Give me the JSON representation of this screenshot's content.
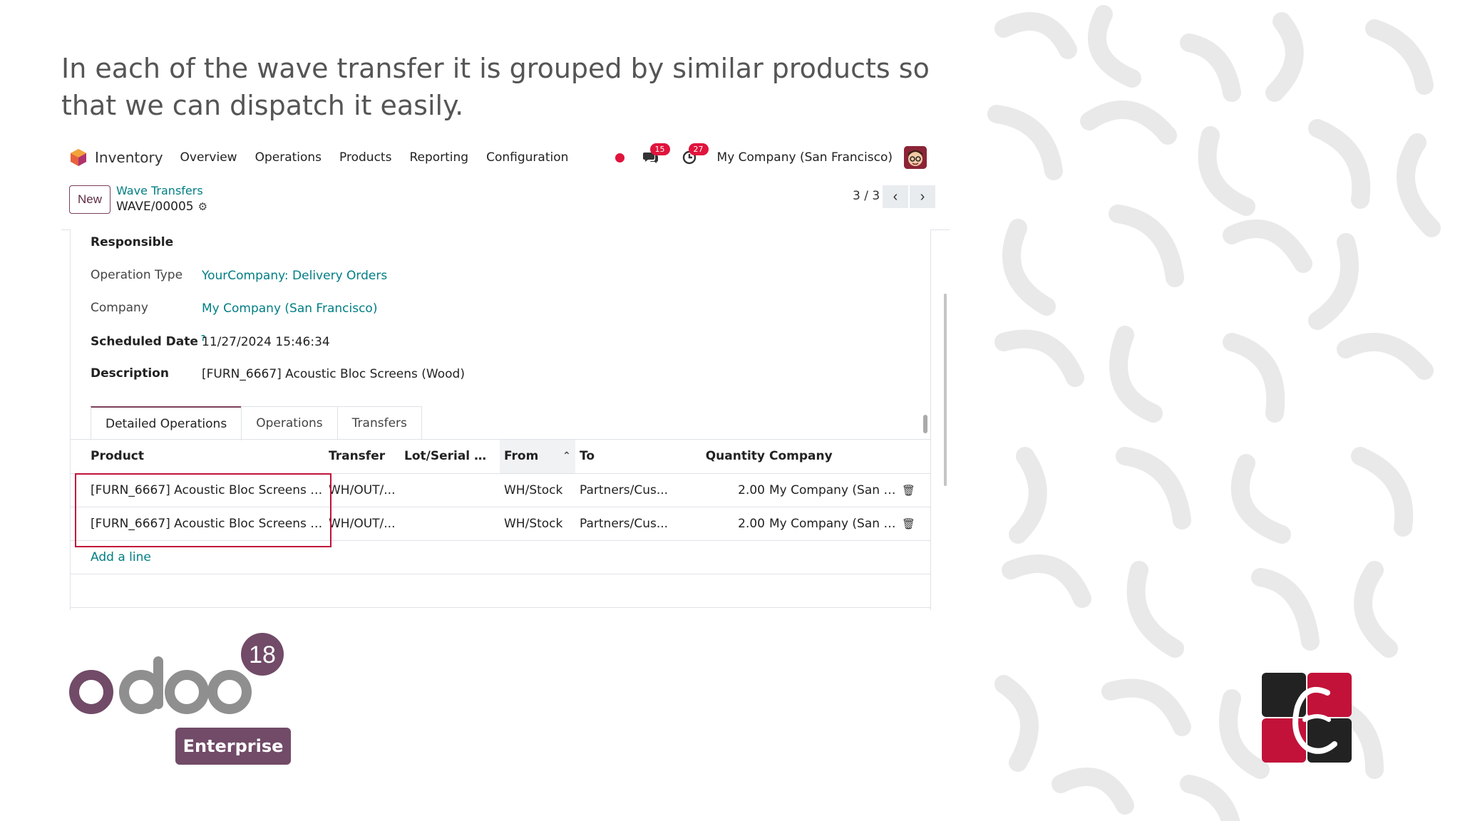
{
  "caption": "In each of the wave transfer it is grouped by similar products so that we can dispatch it easily.",
  "navbar": {
    "app_name": "Inventory",
    "menu": [
      "Overview",
      "Operations",
      "Products",
      "Reporting",
      "Configuration"
    ],
    "messages_count": "15",
    "activities_count": "27",
    "company": "My Company (San Francisco)"
  },
  "control": {
    "new_label": "New",
    "breadcrumb": "Wave Transfers",
    "record": "WAVE/00005",
    "pager": "3 / 3"
  },
  "fields": {
    "responsible_label": "Responsible",
    "operation_type_label": "Operation Type",
    "operation_type_value": "YourCompany: Delivery Orders",
    "company_label": "Company",
    "company_value": "My Company (San Francisco)",
    "scheduled_date_label": "Scheduled Date",
    "scheduled_date_help": "?",
    "scheduled_date_value": "11/27/2024 15:46:34",
    "description_label": "Description",
    "description_value": "[FURN_6667] Acoustic Bloc Screens (Wood)"
  },
  "tabs": [
    "Detailed Operations",
    "Operations",
    "Transfers"
  ],
  "table": {
    "columns": [
      "Product",
      "Transfer",
      "Lot/Serial N...",
      "From",
      "To",
      "Quantity",
      "Company"
    ],
    "rows": [
      {
        "product": "[FURN_6667] Acoustic Bloc Screens (Wo...",
        "transfer": "WH/OUT/...",
        "lot": "",
        "from": "WH/Stock",
        "to": "Partners/Cus...",
        "quantity": "2.00",
        "company": "My Company (San Fra..."
      },
      {
        "product": "[FURN_6667] Acoustic Bloc Screens (Wo...",
        "transfer": "WH/OUT/...",
        "lot": "",
        "from": "WH/Stock",
        "to": "Partners/Cus...",
        "quantity": "2.00",
        "company": "My Company (San Fra..."
      }
    ],
    "add_line": "Add a line"
  },
  "branding": {
    "odoo_text": "odoo",
    "version": "18",
    "edition": "Enterprise",
    "colors": {
      "odoo_purple": "#714b67",
      "odoo_gray": "#8f8f8f",
      "accent_red": "#c2123a",
      "link_teal": "#017e84"
    }
  }
}
